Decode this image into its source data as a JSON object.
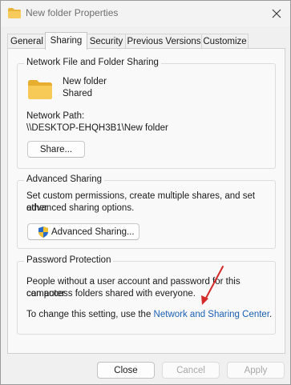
{
  "window": {
    "title": "New folder Properties",
    "close_icon": "close-icon"
  },
  "tabs": [
    {
      "label": "General",
      "active": false
    },
    {
      "label": "Sharing",
      "active": true
    },
    {
      "label": "Security",
      "active": false
    },
    {
      "label": "Previous Versions",
      "active": false
    },
    {
      "label": "Customize",
      "active": false
    }
  ],
  "network_sharing": {
    "group_title": "Network File and Folder Sharing",
    "folder_name": "New folder",
    "folder_status": "Shared",
    "path_label": "Network Path:",
    "path_value": "\\\\DESKTOP-EHQH3B1\\New folder",
    "share_button": "Share..."
  },
  "advanced_sharing": {
    "group_title": "Advanced Sharing",
    "description_line1": "Set custom permissions, create multiple shares, and set other",
    "description_line2": "advanced sharing options.",
    "button_label": "Advanced Sharing..."
  },
  "password_protection": {
    "group_title": "Password Protection",
    "description_line1": "People without a user account and password for this computer",
    "description_line2": "can access folders shared with everyone.",
    "change_prefix": "To change this setting, use the ",
    "link_text": "Network and Sharing Center",
    "change_suffix": "."
  },
  "footer": {
    "close": "Close",
    "cancel": "Cancel",
    "apply": "Apply"
  },
  "colors": {
    "accent_link": "#1a5fb4",
    "annotation_arrow": "#d62a2a",
    "folder_yellow": "#f3c24f"
  }
}
